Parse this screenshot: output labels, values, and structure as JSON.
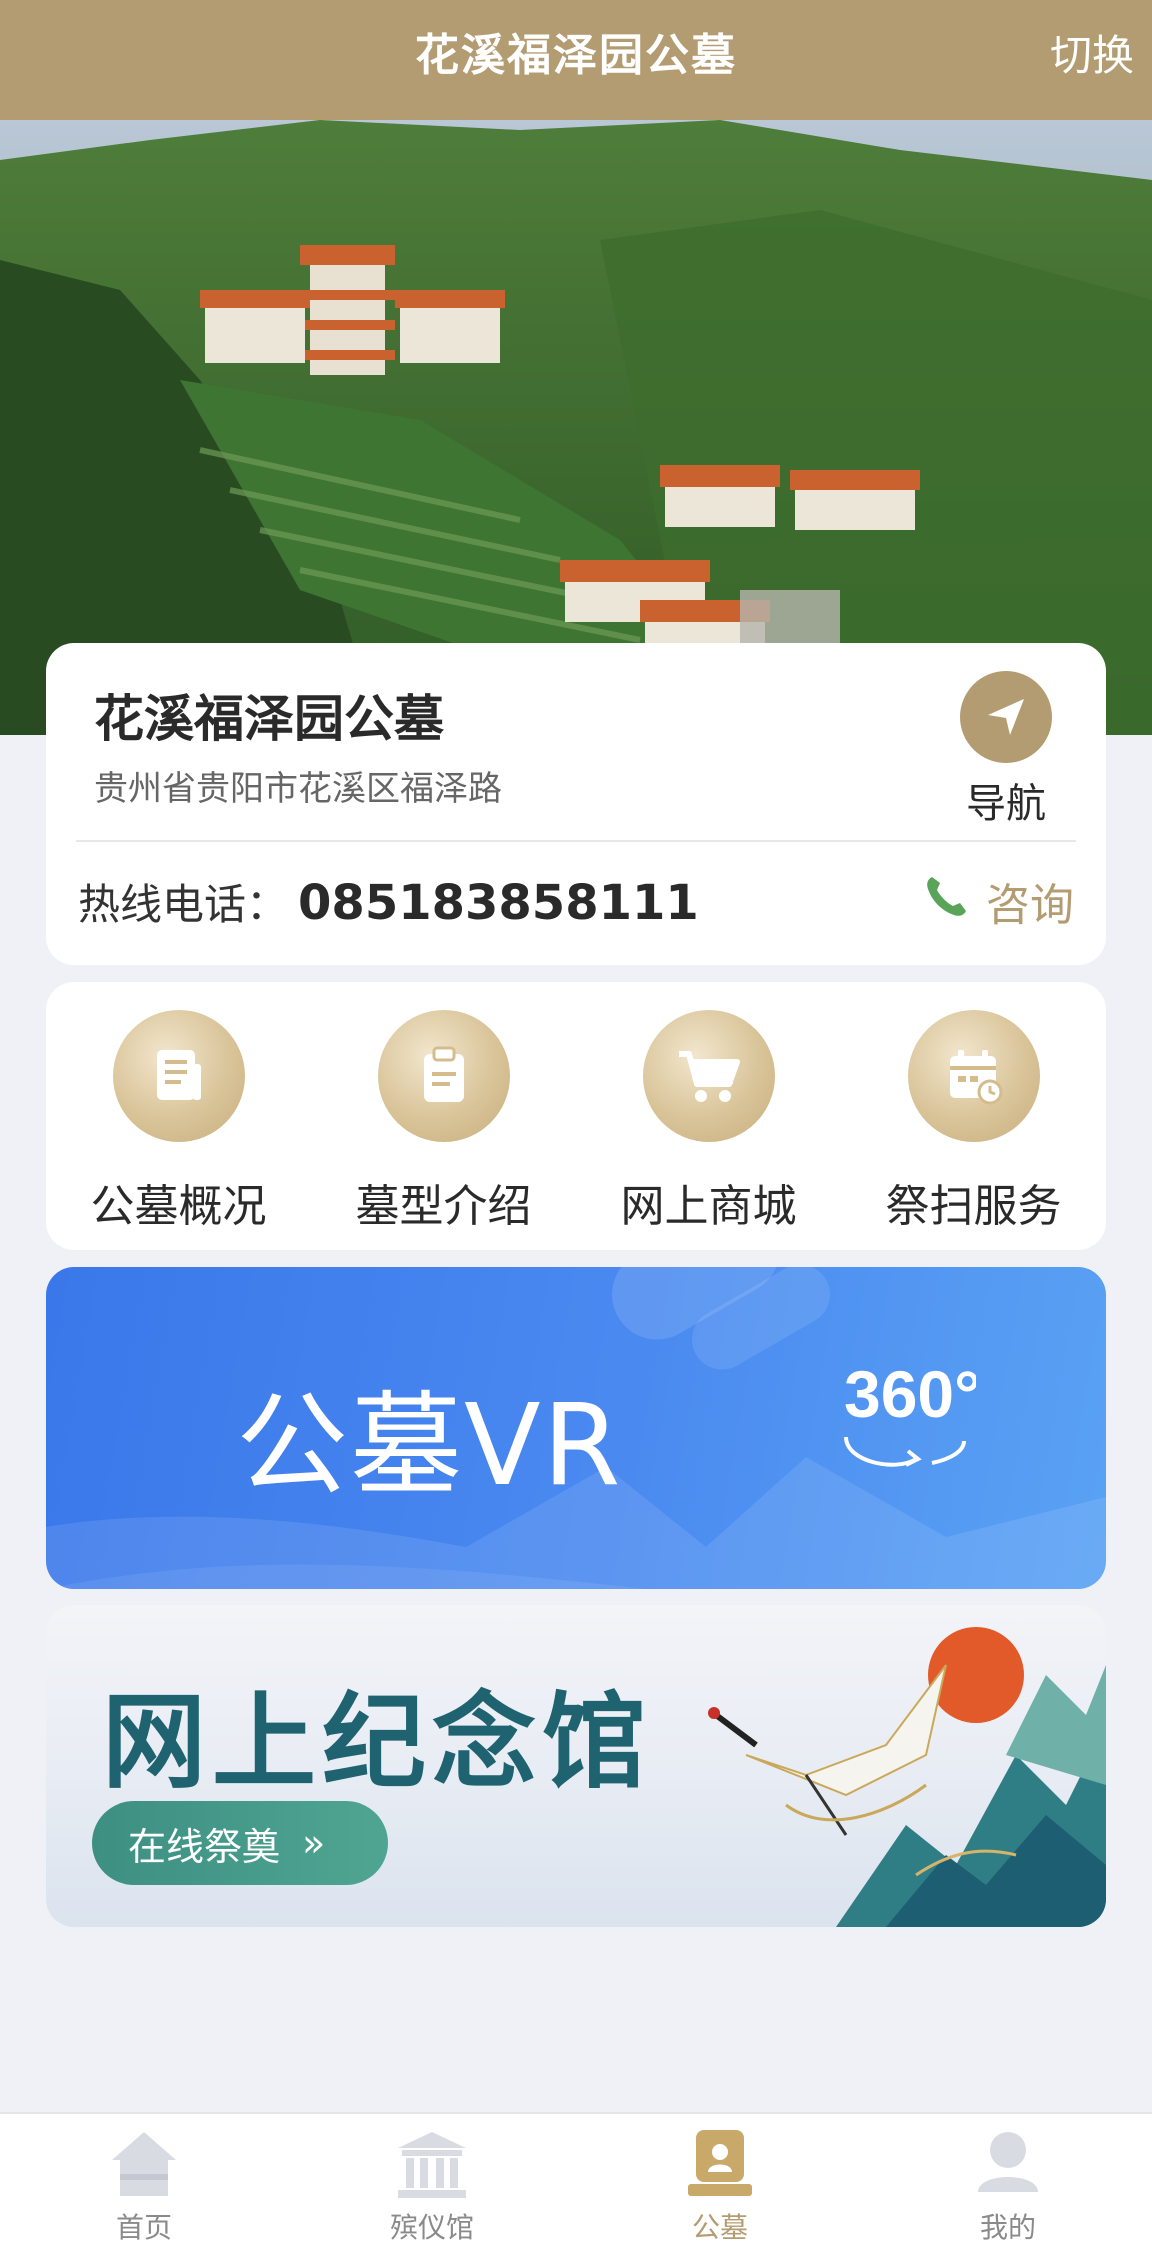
{
  "header": {
    "title": "花溪福泽园公墓",
    "switch_label": "切换"
  },
  "cemetery": {
    "name": "花溪福泽园公墓",
    "address": "贵州省贵阳市花溪区福泽路",
    "nav_label": "导航",
    "hotline_label": "热线电话：",
    "hotline_number": "085183858111",
    "consult_label": "咨询"
  },
  "menu": {
    "items": [
      {
        "label": "公墓概况",
        "icon": "document-icon"
      },
      {
        "label": "墓型介绍",
        "icon": "clipboard-icon"
      },
      {
        "label": "网上商城",
        "icon": "cart-icon"
      },
      {
        "label": "祭扫服务",
        "icon": "calendar-clock-icon"
      }
    ]
  },
  "vr_banner": {
    "title": "公墓VR",
    "badge": "360°"
  },
  "memorial_banner": {
    "title": "网上纪念馆",
    "button_label": "在线祭奠",
    "button_arrow": "»"
  },
  "tabbar": {
    "items": [
      {
        "label": "首页",
        "icon": "home-icon"
      },
      {
        "label": "殡仪馆",
        "icon": "funeral-hall-icon"
      },
      {
        "label": "公墓",
        "icon": "cemetery-icon",
        "active": true
      },
      {
        "label": "我的",
        "icon": "user-icon"
      }
    ]
  },
  "colors": {
    "brand": "#b49c72",
    "vr_blue": "#3a77ea",
    "memorial_teal": "#1f6270"
  }
}
